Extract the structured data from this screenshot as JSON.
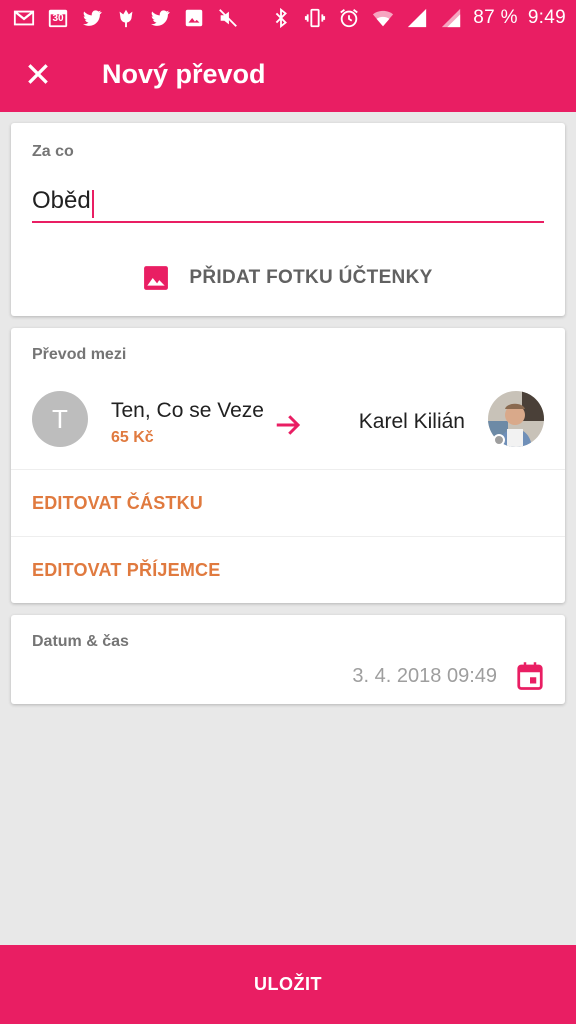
{
  "status_bar": {
    "left_icons": [
      "gmail-icon",
      "calendar-icon",
      "twitter-icon",
      "tulip-icon",
      "twitter-icon",
      "image-icon",
      "mute-icon"
    ],
    "calendar_day": "30",
    "right_icons": [
      "bluetooth-icon",
      "vibrate-icon",
      "alarm-icon",
      "wifi-icon",
      "signal-icon",
      "signal-icon"
    ],
    "battery": "87 %",
    "time": "9:49"
  },
  "app_bar": {
    "title": "Nový převod"
  },
  "expense": {
    "label": "Za co",
    "value": "Oběd",
    "photo_button_label": "PŘIDAT FOTKU ÚČTENKY"
  },
  "transfer": {
    "label": "Převod mezi",
    "from": {
      "initial": "T",
      "name": "Ten, Co se Veze",
      "amount": "65 Kč"
    },
    "to": {
      "name": "Karel Kilián"
    },
    "edit_amount_label": "EDITOVAT ČÁSTKU",
    "edit_recipient_label": "EDITOVAT PŘÍJEMCE"
  },
  "datetime": {
    "label": "Datum & čas",
    "value": "3. 4. 2018 09:49"
  },
  "save_label": "ULOŽIT",
  "colors": {
    "primary": "#e91e63",
    "accent": "#e07a3f",
    "background": "#e8e8e8"
  }
}
